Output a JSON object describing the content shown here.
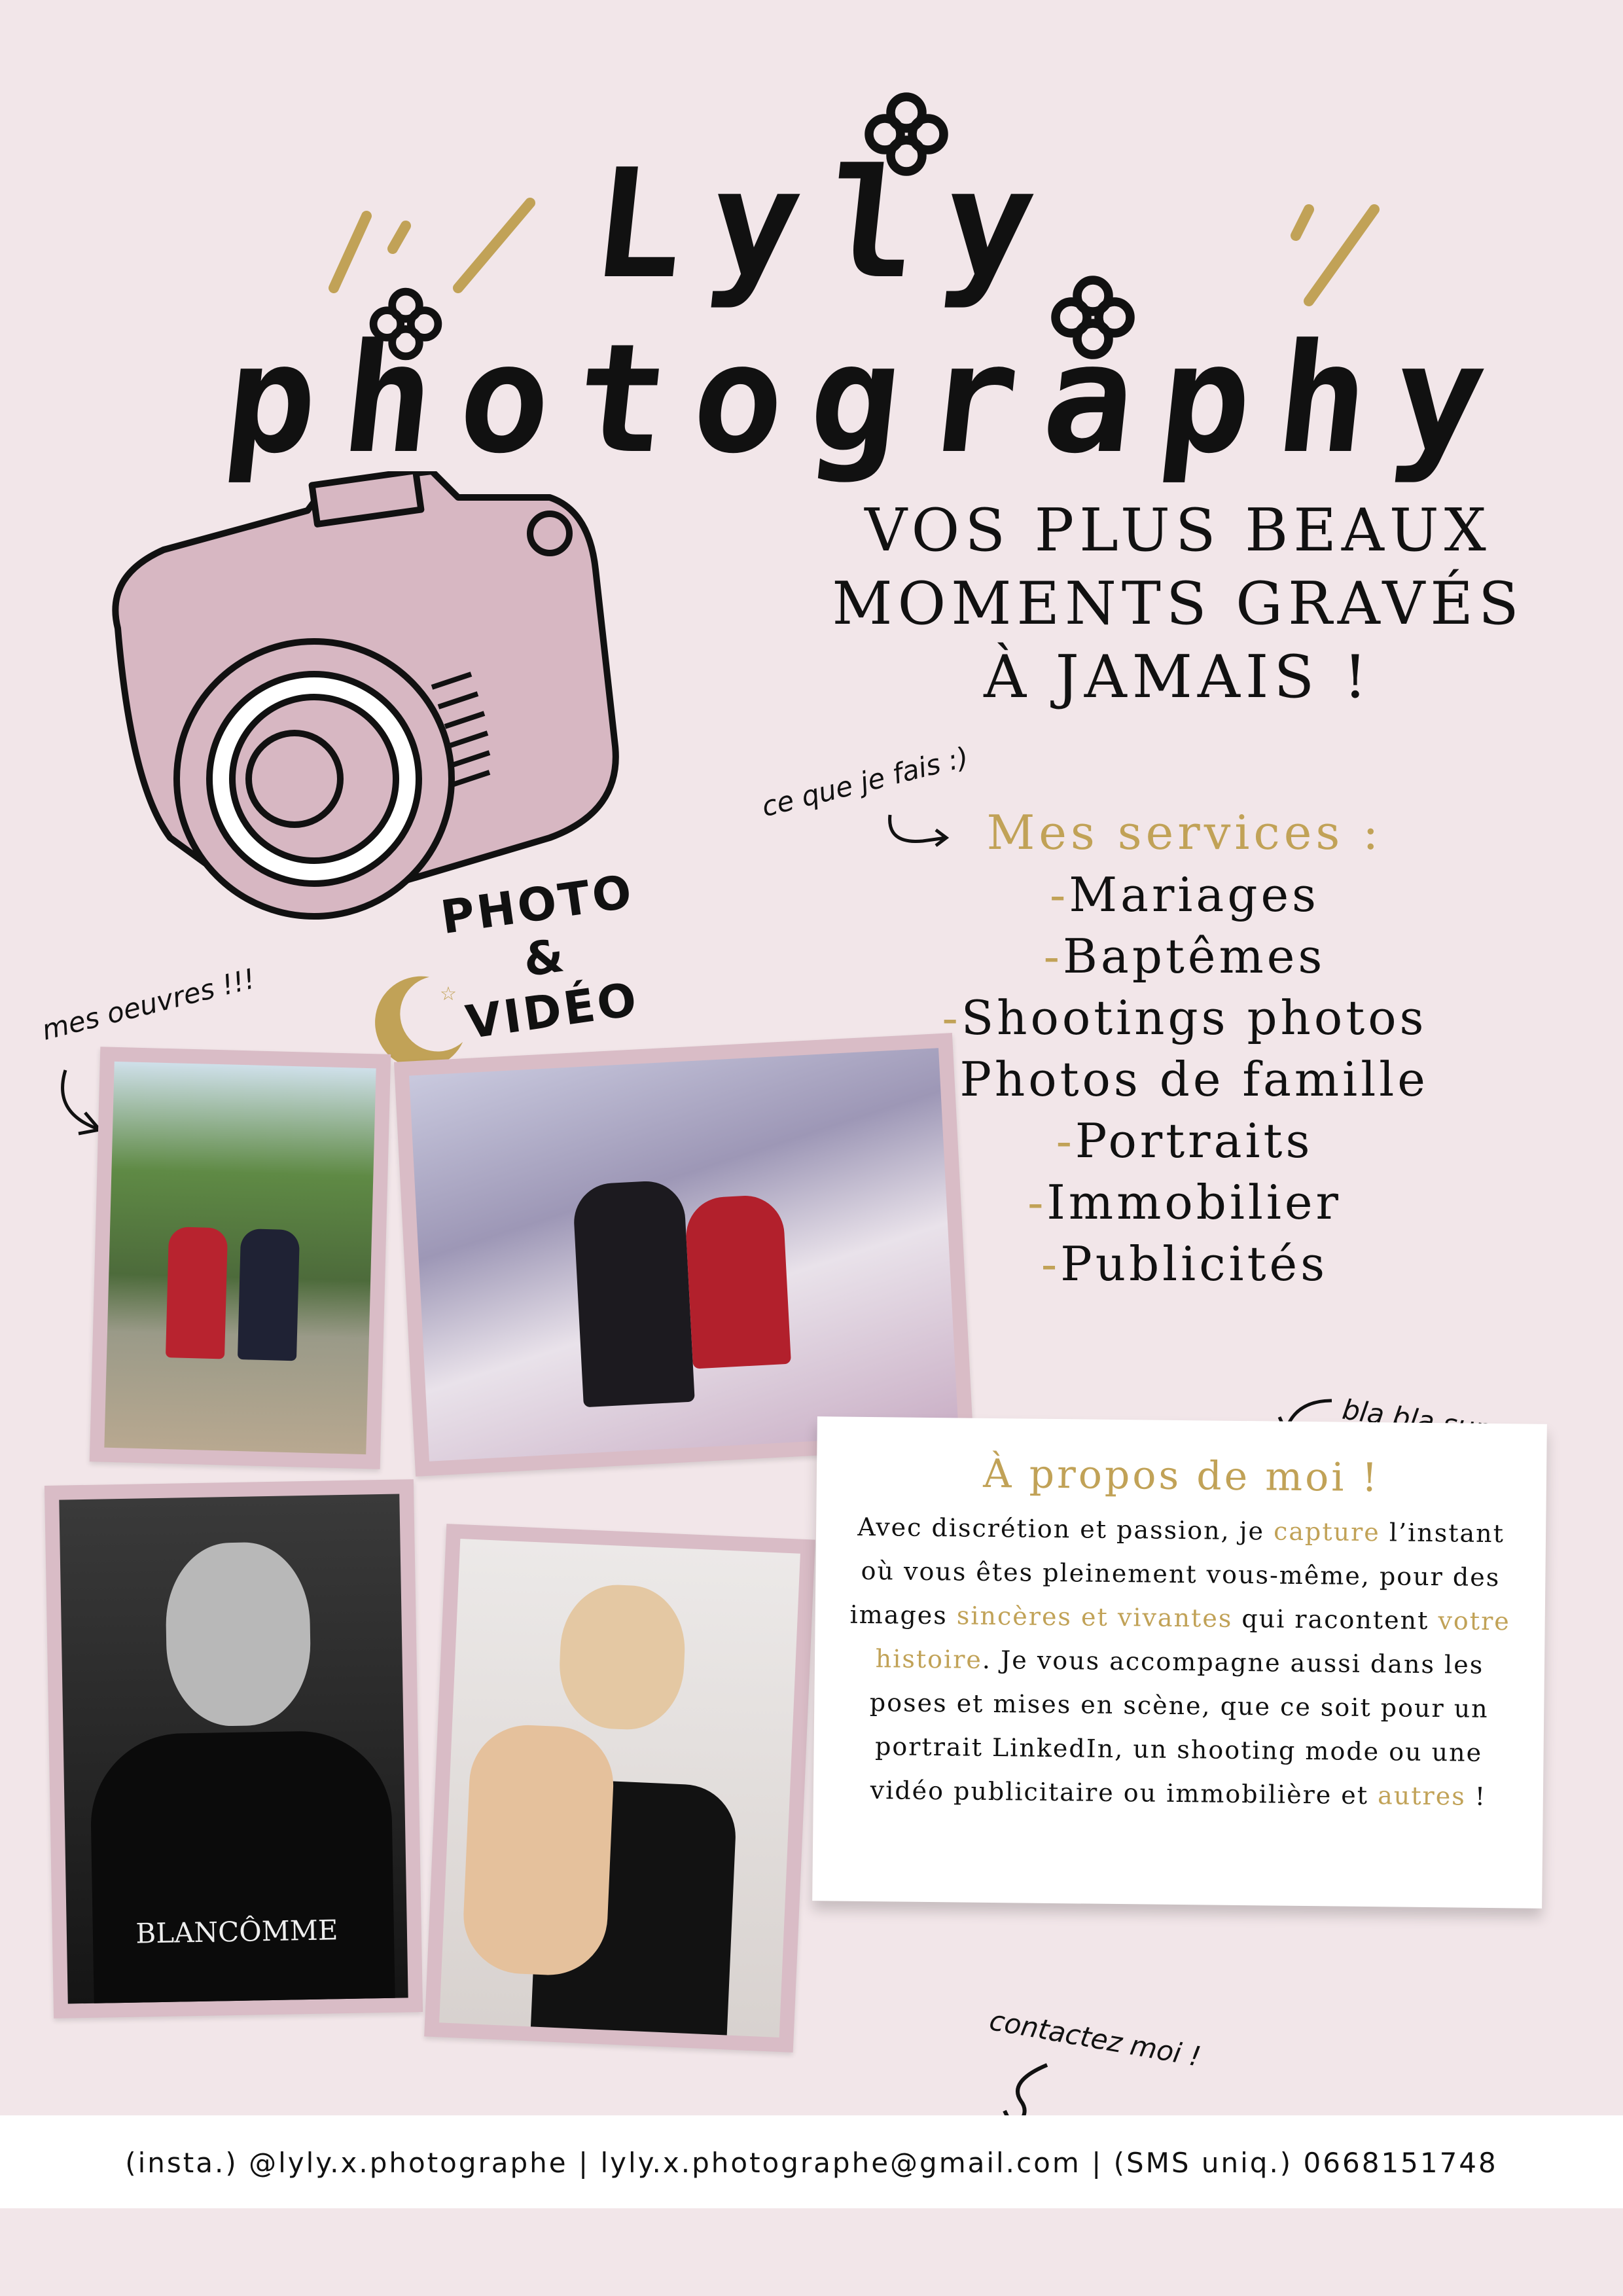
{
  "logo": {
    "text": "Lyly photography"
  },
  "headline": {
    "line1": "VOS PLUS BEAUX",
    "line2": "MOMENTS GRAVÉS",
    "line3": "À JAMAIS !"
  },
  "notes": {
    "services_note": "ce que je fais :)",
    "works_note": "mes oeuvres !!!",
    "about_note": "bla bla sur moi",
    "contact_note": "contactez moi !"
  },
  "badge": {
    "line1": "PHOTO",
    "line2": "&",
    "line3": "VIDÉO"
  },
  "services": {
    "title": "Mes services :",
    "items": [
      "Mariages",
      "Baptêmes",
      "Shootings photos",
      "Photos de famille",
      "Portraits",
      "Immobilier",
      "Publicités"
    ]
  },
  "photos": {
    "watermark": "BLANCÔMME"
  },
  "about": {
    "title": "À propos de moi !",
    "p1": "Avec discrétion et passion, je ",
    "h1": "capture",
    "p2": " l’instant où vous êtes pleinement vous-même, pour des images ",
    "h2": "sincères et vivantes",
    "p3": " qui racontent ",
    "h3": "votre histoire",
    "p4": ". Je vous accompagne aussi dans les poses et mises en scène, que ce soit pour un portrait LinkedIn, un shooting mode ou une vidéo publicitaire ou immobilière et ",
    "h4": "autres",
    "p5": " !"
  },
  "footer": {
    "contact": "(insta.) @lyly.x.photographe | lyly.x.photographe@gmail.com | (SMS uniq.) 0668151748"
  },
  "colors": {
    "background": "#f2e6e9",
    "accent": "#c1a257",
    "camera": "#d7b7c2"
  }
}
